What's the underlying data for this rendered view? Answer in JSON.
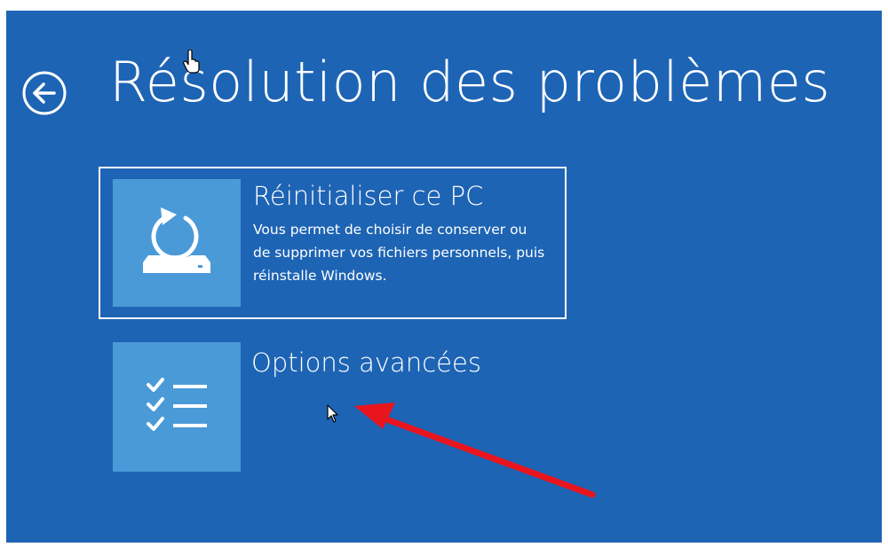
{
  "page": {
    "title": "Résolution des problèmes",
    "background_color": "#1e64b4",
    "tile_color": "#4a9ad8",
    "annotation_color": "#e8141e"
  },
  "back": {
    "icon": "back-arrow-circle-icon"
  },
  "options": [
    {
      "title": "Réinitialiser ce PC",
      "description": "Vous permet de choisir de conserver ou de supprimer vos fichiers personnels, puis réinstalle Windows.",
      "icon": "reset-pc-icon",
      "selected": true
    },
    {
      "title": "Options avancées",
      "description": "",
      "icon": "checklist-icon",
      "selected": false
    }
  ]
}
